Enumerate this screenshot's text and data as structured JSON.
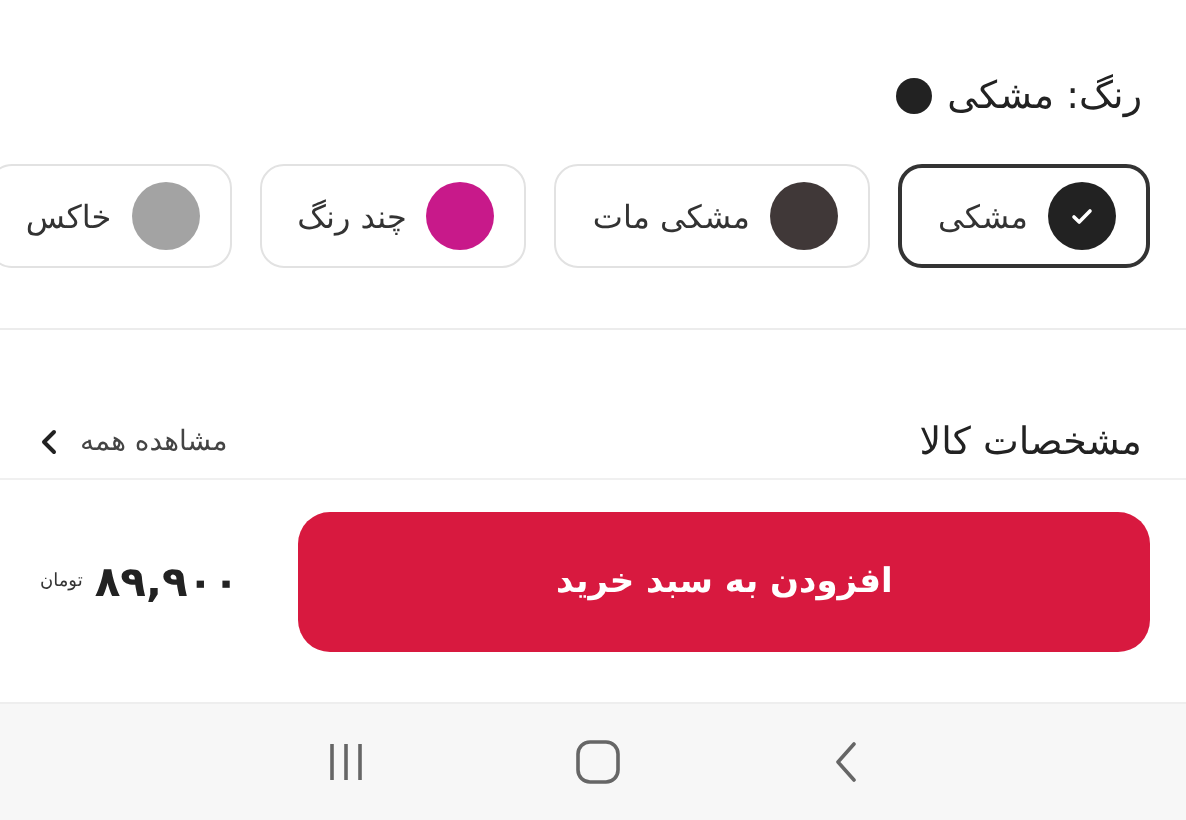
{
  "color_picker": {
    "label": "رنگ:",
    "value": "مشکی",
    "color": "#222222",
    "options": [
      {
        "name": "مشکی",
        "color": "#222222",
        "selected": true
      },
      {
        "name": "مشکی مات",
        "color": "#403838",
        "selected": false
      },
      {
        "name": "چند رنگ",
        "color": "#c8198a",
        "selected": false
      },
      {
        "name": "خاکس",
        "color": "#a3a3a3",
        "selected": false
      }
    ]
  },
  "specs": {
    "title": "مشخصات کالا",
    "link": "مشاهده همه"
  },
  "buy_bar": {
    "button": "افزودن به سبد خرید",
    "price": "۸۹,۹۰۰",
    "currency": "تومان"
  }
}
